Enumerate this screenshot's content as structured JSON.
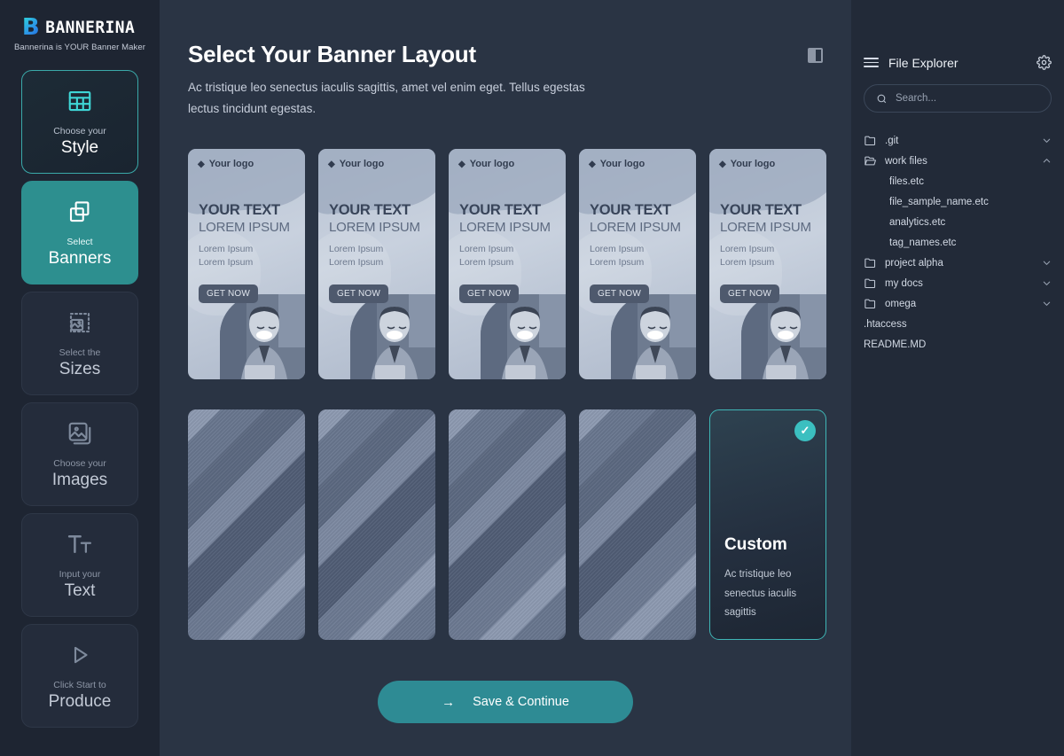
{
  "brand": {
    "logo_mark": "B",
    "logo_word": "BANNERINA",
    "tagline": "Bannerina is YOUR Banner Maker",
    "accent_teal": "#2d8f8f",
    "accent_cyan": "#3bbfc0"
  },
  "sidebar": {
    "items": [
      {
        "sub": "Choose your",
        "main": "Style",
        "icon": "table-grid-icon",
        "state": "outlined"
      },
      {
        "sub": "Select",
        "main": "Banners",
        "icon": "copy-layers-icon",
        "state": "active"
      },
      {
        "sub": "Select the",
        "main": "Sizes",
        "icon": "crop-image-icon",
        "state": "idle"
      },
      {
        "sub": "Choose your",
        "main": "Images",
        "icon": "image-stack-icon",
        "state": "idle"
      },
      {
        "sub": "Input your",
        "main": "Text",
        "icon": "text-format-icon",
        "state": "idle"
      },
      {
        "sub": "Click Start to",
        "main": "Produce",
        "icon": "play-icon",
        "state": "idle"
      }
    ]
  },
  "main": {
    "title": "Select Your Banner Layout",
    "description": "Ac tristique leo senectus iaculis sagittis, amet vel enim eget. Tellus egestas lectus tincidunt egestas.",
    "panel_toggle_icon": "panel-layout-icon",
    "banner_template": {
      "logo_label": "Your logo",
      "headline": "YOUR TEXT",
      "subhead": "LOREM IPSUM",
      "body_line1": "Lorem Ipsum",
      "body_line2": "Lorem Ipsum",
      "cta": "GET NOW"
    },
    "banner_count": 5,
    "texture_count": 4,
    "custom_card": {
      "title": "Custom",
      "description": "Ac tristique leo senectus iaculis sagittis",
      "selected": true,
      "check_icon": "check-icon"
    },
    "save_button": {
      "label": "Save & Continue",
      "icon": "arrow-right-icon"
    }
  },
  "file_explorer": {
    "title": "File Explorer",
    "menu_icon": "hamburger-icon",
    "settings_icon": "gear-icon",
    "search_placeholder": "Search...",
    "search_value": "",
    "search_icon": "search-icon",
    "tree": [
      {
        "name": ".git",
        "type": "folder",
        "expanded": false,
        "indent": 0
      },
      {
        "name": "work files",
        "type": "folder-open",
        "expanded": true,
        "indent": 0
      },
      {
        "name": "files.etc",
        "type": "file",
        "indent": 1
      },
      {
        "name": "file_sample_name.etc",
        "type": "file",
        "indent": 1
      },
      {
        "name": "analytics.etc",
        "type": "file",
        "indent": 1
      },
      {
        "name": "tag_names.etc",
        "type": "file",
        "indent": 1
      },
      {
        "name": "project alpha",
        "type": "folder",
        "expanded": false,
        "indent": 0
      },
      {
        "name": "my docs",
        "type": "folder",
        "expanded": false,
        "indent": 0
      },
      {
        "name": "omega",
        "type": "folder",
        "expanded": false,
        "indent": 0
      },
      {
        "name": ".htaccess",
        "type": "root-file",
        "indent": 0
      },
      {
        "name": "README.MD",
        "type": "root-file",
        "indent": 0
      }
    ]
  }
}
